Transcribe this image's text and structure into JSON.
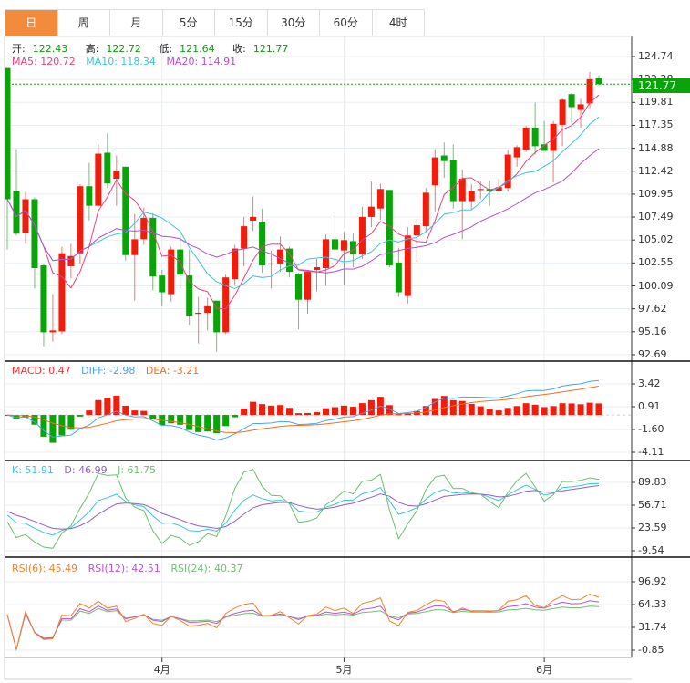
{
  "tabs": [
    {
      "label": "日",
      "active": true
    },
    {
      "label": "周"
    },
    {
      "label": "月"
    },
    {
      "label": "5分"
    },
    {
      "label": "15分"
    },
    {
      "label": "30分"
    },
    {
      "label": "60分"
    },
    {
      "label": "4时"
    }
  ],
  "ohlc": {
    "open_label": "开:",
    "open": "122.43",
    "high_label": "高:",
    "high": "122.72",
    "low_label": "低:",
    "low": "121.64",
    "close_label": "收:",
    "close": "121.77"
  },
  "ma": {
    "ma5": "MA5: 120.72",
    "ma10": "MA10: 118.34",
    "ma20": "MA20: 114.91"
  },
  "macd_legend": {
    "macd": "MACD: 0.47",
    "diff": "DIFF: -2.98",
    "dea": "DEA: -3.21"
  },
  "kdj_legend": {
    "k": "K: 51.91",
    "d": "D: 46.99",
    "j": "J: 61.75"
  },
  "rsi_legend": {
    "rsi6": "RSI(6): 45.49",
    "rsi12": "RSI(12): 42.51",
    "rsi24": "RSI(24): 40.37"
  },
  "price_tag": "121.77",
  "colors": {
    "up": "#f01c0c",
    "down": "#0aa30a",
    "ma5": "#e8417f",
    "ma10": "#3cc4dc",
    "ma20": "#b44fc8",
    "diff": "#4aa3e8",
    "dea": "#f07020",
    "k": "#3cc4dc",
    "d": "#9060c8",
    "j": "#6cc06c",
    "rsi6": "#f5822a",
    "rsi12": "#c050d0",
    "rsi24": "#70c070",
    "tab_active": "#f28b3c"
  },
  "chart_data": {
    "type": "candlestick",
    "ohlc_order": [
      "open",
      "high",
      "low",
      "close"
    ],
    "candles": [
      [
        123.5,
        123.5,
        104.0,
        109.4
      ],
      [
        110.3,
        114.8,
        105.5,
        105.7
      ],
      [
        105.8,
        110.2,
        104.6,
        109.4
      ],
      [
        109.4,
        109.6,
        99.8,
        102.0
      ],
      [
        102.3,
        102.5,
        93.6,
        95.1
      ],
      [
        95.1,
        99.2,
        94.1,
        95.3
      ],
      [
        95.2,
        104.3,
        94.9,
        103.6
      ],
      [
        102.2,
        104.6,
        100.9,
        103.3
      ],
      [
        103.6,
        111.0,
        102.5,
        110.8
      ],
      [
        110.8,
        113.3,
        107.1,
        108.7
      ],
      [
        108.7,
        115.3,
        108.5,
        114.3
      ],
      [
        114.4,
        116.5,
        110.6,
        111.1
      ],
      [
        111.6,
        114.1,
        108.7,
        112.5
      ],
      [
        112.9,
        112.9,
        102.8,
        103.4
      ],
      [
        103.4,
        107.8,
        98.5,
        105.1
      ],
      [
        105.1,
        108.5,
        104.5,
        107.4
      ],
      [
        107.4,
        107.9,
        99.6,
        101.1
      ],
      [
        101.2,
        101.8,
        97.9,
        99.4
      ],
      [
        99.2,
        104.3,
        98.4,
        104.0
      ],
      [
        104.0,
        105.8,
        99.8,
        101.3
      ],
      [
        101.2,
        104.0,
        95.9,
        96.9
      ],
      [
        97.1,
        98.9,
        93.9,
        97.2
      ],
      [
        97.2,
        98.8,
        95.3,
        97.9
      ],
      [
        98.5,
        98.5,
        93.0,
        95.1
      ],
      [
        95.1,
        101.3,
        94.9,
        101.0
      ],
      [
        100.8,
        104.5,
        100.1,
        104.1
      ],
      [
        104.1,
        107.5,
        102.2,
        106.5
      ],
      [
        107.1,
        109.7,
        106.0,
        107.5
      ],
      [
        107.0,
        108.4,
        101.5,
        102.3
      ],
      [
        102.4,
        103.9,
        99.8,
        102.5
      ],
      [
        102.5,
        105.4,
        101.6,
        104.0
      ],
      [
        104.1,
        104.3,
        101.0,
        101.6
      ],
      [
        101.4,
        101.5,
        95.4,
        98.6
      ],
      [
        98.6,
        101.8,
        97.1,
        101.6
      ],
      [
        101.8,
        103.0,
        99.5,
        102.1
      ],
      [
        102.0,
        105.6,
        100.1,
        105.1
      ],
      [
        105.1,
        108.0,
        103.8,
        104.0
      ],
      [
        103.9,
        105.9,
        100.2,
        105.0
      ],
      [
        104.9,
        105.7,
        102.1,
        103.5
      ],
      [
        103.5,
        108.6,
        103.0,
        107.5
      ],
      [
        107.5,
        111.3,
        106.4,
        108.6
      ],
      [
        108.4,
        111.1,
        107.2,
        110.5
      ],
      [
        110.4,
        110.4,
        102.1,
        102.3
      ],
      [
        102.6,
        104.2,
        98.9,
        99.4
      ],
      [
        99.0,
        106.4,
        98.2,
        105.5
      ],
      [
        105.5,
        107.3,
        102.7,
        106.6
      ],
      [
        106.5,
        110.6,
        105.9,
        110.1
      ],
      [
        110.9,
        114.8,
        108.1,
        113.9
      ],
      [
        114.1,
        115.5,
        111.7,
        113.5
      ],
      [
        113.6,
        115.3,
        108.4,
        109.2
      ],
      [
        109.2,
        112.6,
        105.1,
        111.6
      ],
      [
        109.2,
        111.0,
        108.3,
        110.3
      ],
      [
        110.5,
        111.3,
        109.4,
        110.5
      ],
      [
        110.5,
        111.4,
        108.7,
        110.3
      ],
      [
        110.3,
        111.6,
        110.2,
        110.7
      ],
      [
        110.6,
        114.7,
        110.2,
        114.2
      ],
      [
        113.9,
        115.2,
        112.9,
        115.0
      ],
      [
        114.7,
        117.3,
        114.5,
        117.1
      ],
      [
        117.1,
        119.8,
        114.2,
        115.1
      ],
      [
        115.3,
        117.8,
        114.6,
        114.6
      ],
      [
        114.6,
        117.8,
        111.2,
        117.5
      ],
      [
        117.4,
        120.3,
        115.1,
        120.1
      ],
      [
        120.7,
        120.8,
        117.6,
        119.3
      ],
      [
        119.0,
        120.2,
        117.1,
        119.6
      ],
      [
        119.7,
        123.1,
        119.2,
        122.3
      ],
      [
        122.43,
        122.72,
        121.64,
        121.77
      ]
    ],
    "price_axis": {
      "ticks": [
        "124.74",
        "122.28",
        "119.81",
        "117.35",
        "114.88",
        "112.42",
        "109.95",
        "107.49",
        "105.02",
        "102.55",
        "100.09",
        "97.62",
        "95.16",
        "92.69"
      ],
      "range": [
        92.69,
        124.74
      ]
    },
    "macd_axis": {
      "ticks": [
        "3.42",
        "0.91",
        "-1.60",
        "-4.11"
      ],
      "range": [
        -4.11,
        3.42
      ]
    },
    "kdj_axis": {
      "ticks": [
        "89.83",
        "56.71",
        "23.59",
        "-9.54"
      ],
      "range": [
        -9.54,
        89.83
      ]
    },
    "rsi_axis": {
      "ticks": [
        "96.92",
        "64.33",
        "31.74",
        "-0.85"
      ],
      "range": [
        -0.85,
        96.92
      ]
    },
    "x_ticks": [
      {
        "label": "4月",
        "index": 17
      },
      {
        "label": "5月",
        "index": 37
      },
      {
        "label": "6月",
        "index": 59
      }
    ],
    "last_close": 121.77,
    "indicators": {
      "ma": [
        5,
        10,
        20
      ],
      "macd": [
        12,
        26,
        9
      ],
      "kdj": [
        9,
        3,
        3
      ],
      "rsi": [
        6,
        12,
        24
      ]
    }
  }
}
